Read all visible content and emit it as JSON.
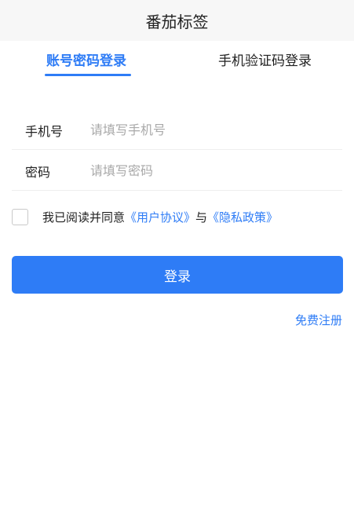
{
  "header": {
    "title": "番茄标签"
  },
  "tabs": [
    {
      "label": "账号密码登录",
      "active": true
    },
    {
      "label": "手机验证码登录",
      "active": false
    }
  ],
  "form": {
    "phone": {
      "label": "手机号",
      "placeholder": "请填写手机号",
      "value": ""
    },
    "password": {
      "label": "密码",
      "placeholder": "请填写密码",
      "value": ""
    }
  },
  "agreement": {
    "checked": false,
    "prefix": "我已阅读并同意",
    "user_agreement": "《用户协议》",
    "separator": "与",
    "privacy_policy": "《隐私政策》"
  },
  "login_button": {
    "label": "登录"
  },
  "register_link": {
    "label": "免费注册"
  },
  "colors": {
    "accent": "#2e7cf6",
    "header_bg": "#f7f7f7",
    "text": "#222222",
    "placeholder": "#a9a9a9"
  }
}
